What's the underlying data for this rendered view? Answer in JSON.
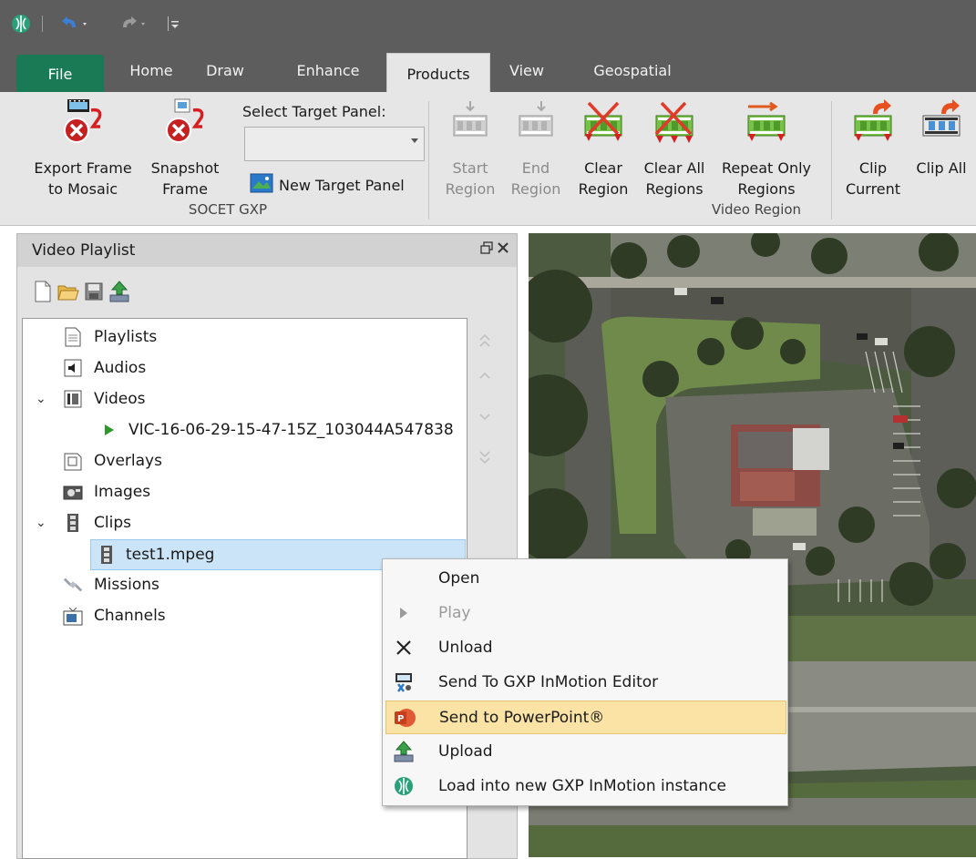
{
  "tabs": [
    "File",
    "Home",
    "Draw",
    "Enhance",
    "Products",
    "View",
    "Geospatial"
  ],
  "active_tab": "Products",
  "ribbon": {
    "socet": {
      "export_frame": "Export Frame\nto Mosaic",
      "snapshot_frame": "Snapshot\nFrame",
      "select_target_label": "Select Target Panel:",
      "select_target_value": "",
      "new_target_panel": "New Target Panel",
      "group_label": "SOCET GXP"
    },
    "video_region": {
      "start_region": "Start\nRegion",
      "end_region": "End\nRegion",
      "clear_region": "Clear\nRegion",
      "clear_all_regions": "Clear All\nRegions",
      "repeat_only_regions": "Repeat Only\nRegions",
      "group_label": "Video Region"
    },
    "clip": {
      "clip_current": "Clip\nCurrent",
      "clip_all": "Clip All"
    }
  },
  "panel": {
    "title": "Video Playlist",
    "tree": [
      {
        "label": "Playlists",
        "icon": "document-icon"
      },
      {
        "label": "Audios",
        "icon": "speaker-icon"
      },
      {
        "label": "Videos",
        "icon": "film-icon",
        "expanded": true
      },
      {
        "label": "VIC-16-06-29-15-47-15Z_103044A547838",
        "icon": "play-triangle-icon",
        "child": true
      },
      {
        "label": "Overlays",
        "icon": "overlay-icon"
      },
      {
        "label": "Images",
        "icon": "camera-icon"
      },
      {
        "label": "Clips",
        "icon": "film-strip-icon",
        "expanded": true
      },
      {
        "label": "test1.mpeg",
        "icon": "film-strip-icon",
        "child": true,
        "selected": true
      },
      {
        "label": "Missions",
        "icon": "satellite-icon"
      },
      {
        "label": "Channels",
        "icon": "tv-icon"
      }
    ]
  },
  "context_menu": [
    {
      "label": "Open",
      "icon": "",
      "disabled": false
    },
    {
      "label": "Play",
      "icon": "play-icon",
      "disabled": true
    },
    {
      "label": "Unload",
      "icon": "close-x-icon",
      "disabled": false
    },
    {
      "label": "Send To GXP InMotion Editor",
      "icon": "editor-icon",
      "disabled": false
    },
    {
      "label": "Send to PowerPoint®",
      "icon": "powerpoint-icon",
      "disabled": false,
      "highlighted": true
    },
    {
      "label": "Upload",
      "icon": "upload-icon",
      "disabled": false
    },
    {
      "label": "Load into new GXP InMotion instance",
      "icon": "inmotion-logo-icon",
      "disabled": false
    }
  ],
  "colors": {
    "file_tab": "#197a55",
    "highlight": "#fbe3a5",
    "selection": "#cce4f7"
  }
}
